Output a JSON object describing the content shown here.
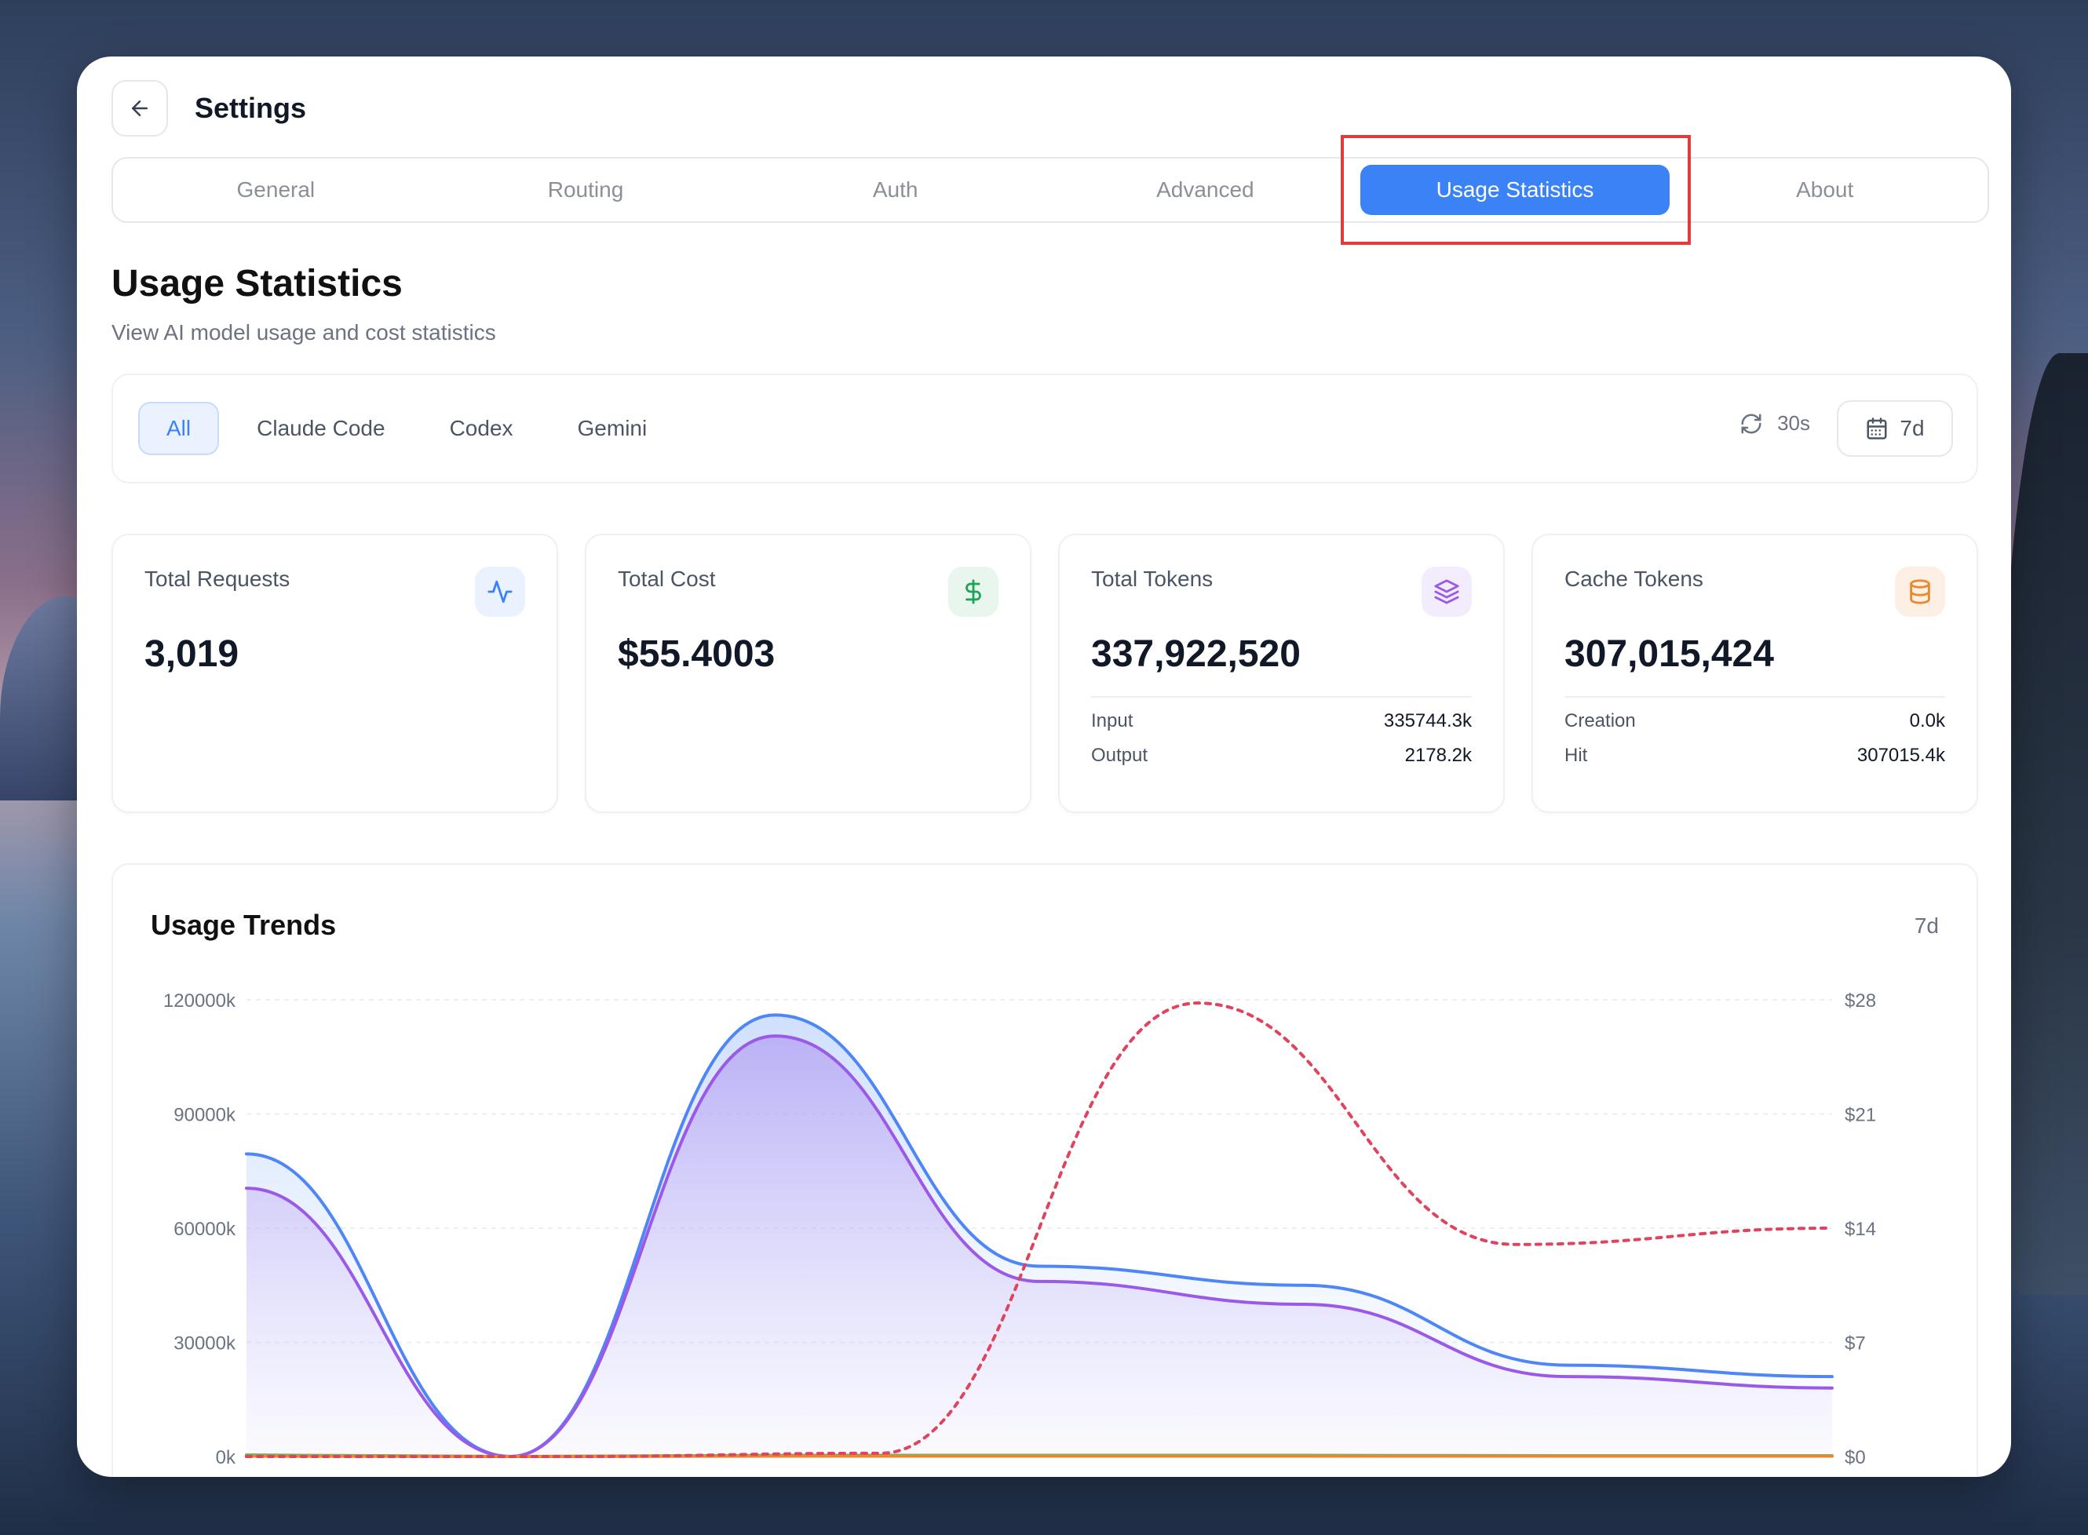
{
  "header": {
    "title": "Settings"
  },
  "tabs": [
    {
      "label": "General"
    },
    {
      "label": "Routing"
    },
    {
      "label": "Auth"
    },
    {
      "label": "Advanced"
    },
    {
      "label": "Usage Statistics"
    },
    {
      "label": "About"
    }
  ],
  "section": {
    "title": "Usage Statistics",
    "subtitle": "View AI model usage and cost statistics"
  },
  "filters": {
    "items": [
      {
        "label": "All"
      },
      {
        "label": "Claude Code"
      },
      {
        "label": "Codex"
      },
      {
        "label": "Gemini"
      }
    ],
    "refresh_label": "30s",
    "range_label": "7d"
  },
  "cards": {
    "requests": {
      "label": "Total Requests",
      "value": "3,019"
    },
    "cost": {
      "label": "Total Cost",
      "value": "$55.4003"
    },
    "tokens": {
      "label": "Total Tokens",
      "value": "337,922,520",
      "rows": [
        {
          "label": "Input",
          "value": "335744.3k"
        },
        {
          "label": "Output",
          "value": "2178.2k"
        }
      ]
    },
    "cache": {
      "label": "Cache Tokens",
      "value": "307,015,424",
      "rows": [
        {
          "label": "Creation",
          "value": "0.0k"
        },
        {
          "label": "Hit",
          "value": "307015.4k"
        }
      ]
    }
  },
  "chart": {
    "title": "Usage Trends",
    "range": "7d"
  },
  "chart_data": {
    "type": "line",
    "x": [
      0,
      1,
      2,
      3,
      4,
      5,
      6
    ],
    "ylim": [
      0,
      120000
    ],
    "y2lim": [
      0,
      28
    ],
    "y_ticks": [
      "0k",
      "30000k",
      "60000k",
      "90000k",
      "120000k"
    ],
    "y2_ticks": [
      "$0",
      "$7",
      "$14",
      "$21",
      "$28"
    ],
    "series": [
      {
        "axis": "left",
        "color": "#4f86f7",
        "values": [
          79500,
          0,
          116000,
          50000,
          45000,
          24000,
          21000
        ]
      },
      {
        "axis": "left",
        "color": "#9b59e8",
        "fill": true,
        "values": [
          70500,
          0,
          110500,
          46000,
          40000,
          21000,
          18000
        ]
      },
      {
        "axis": "left",
        "color": "#5fb36b",
        "values": [
          400,
          0,
          300,
          300,
          300,
          200,
          200
        ]
      },
      {
        "axis": "left",
        "color": "#e8892b",
        "values": [
          100,
          0,
          100,
          100,
          100,
          100,
          100
        ]
      },
      {
        "axis": "right",
        "color": "#e0435c",
        "dashed": true,
        "values": [
          0,
          0,
          0.2,
          27.8,
          13,
          14
        ]
      }
    ],
    "grid": true
  }
}
